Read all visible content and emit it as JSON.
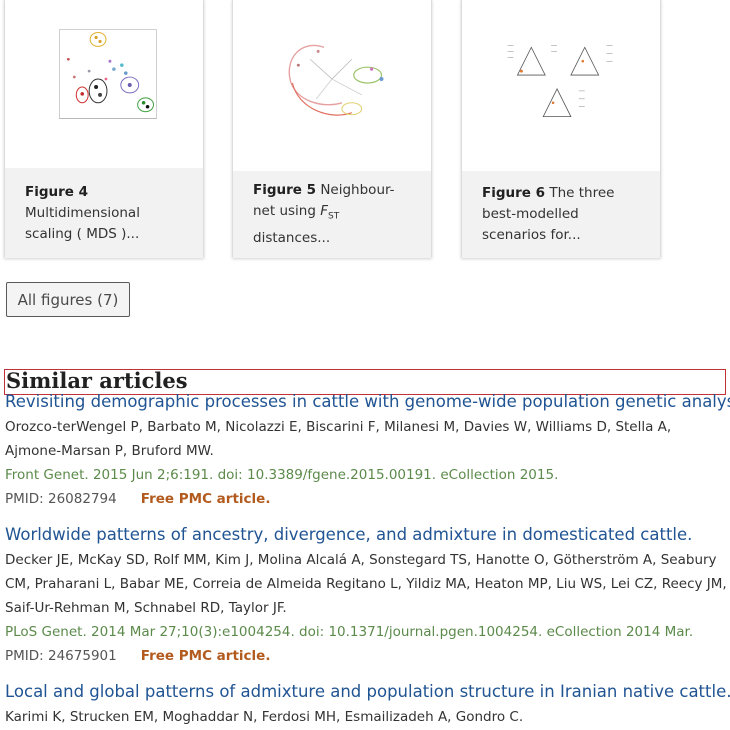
{
  "figures": [
    {
      "label": "Figure 4",
      "caption": "Multidimensional scaling ( MDS )..."
    },
    {
      "label": "Figure 5",
      "caption_pre": "Neighbour-net using ",
      "caption_F": "F",
      "caption_sub": "ST",
      "caption_post": " distances..."
    },
    {
      "label": "Figure 6",
      "caption": "The three best-modelled scenarios for..."
    }
  ],
  "all_figures_label": "All figures (7)",
  "similar_heading": "Similar articles",
  "articles": [
    {
      "title": "Revisiting demographic processes in cattle with genome-wide population genetic analysis.",
      "authors": "Orozco-terWengel P, Barbato M, Nicolazzi E, Biscarini F, Milanesi M, Davies W, Williams D, Stella A, Ajmone-Marsan P, Bruford MW.",
      "citation": "Front Genet. 2015 Jun 2;6:191. doi: 10.3389/fgene.2015.00191. eCollection 2015.",
      "pmid": "PMID: 26082794",
      "free": "Free PMC article."
    },
    {
      "title": "Worldwide patterns of ancestry, divergence, and admixture in domesticated cattle.",
      "authors": "Decker JE, McKay SD, Rolf MM, Kim J, Molina Alcalá A, Sonstegard TS, Hanotte O, Götherström A, Seabury CM, Praharani L, Babar ME, Correia de Almeida Regitano L, Yildiz MA, Heaton MP, Liu WS, Lei CZ, Reecy JM, Saif-Ur-Rehman M, Schnabel RD, Taylor JF.",
      "citation": "PLoS Genet. 2014 Mar 27;10(3):e1004254. doi: 10.1371/journal.pgen.1004254. eCollection 2014 Mar.",
      "pmid": "PMID: 24675901",
      "free": "Free PMC article."
    },
    {
      "title": "Local and global patterns of admixture and population structure in Iranian native cattle.",
      "authors": "Karimi K, Strucken EM, Moghaddar N, Ferdosi MH, Esmailizadeh A, Gondro C."
    }
  ]
}
